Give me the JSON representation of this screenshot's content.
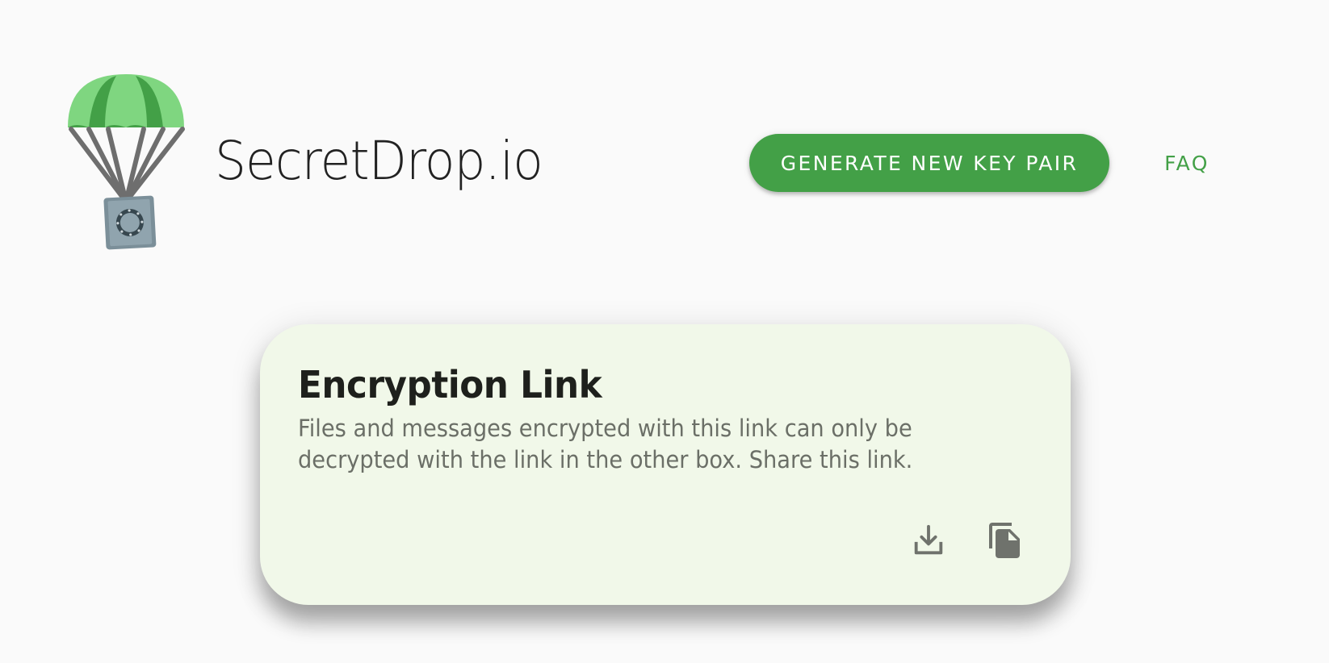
{
  "header": {
    "app_title": "SecretDrop.io",
    "generate_button_label": "GENERATE NEW KEY PAIR",
    "faq_label": "FAQ"
  },
  "card": {
    "title": "Encryption Link",
    "description": "Files and messages encrypted with this link can only be decrypted with the link in the other box. Share this link.",
    "actions": [
      {
        "icon": "download-icon"
      },
      {
        "icon": "copy-icon"
      }
    ]
  },
  "colors": {
    "accent": "#43a047",
    "card_background": "#f1f8e9",
    "page_background": "#fafafa",
    "icon_gray": "#6f726c"
  }
}
